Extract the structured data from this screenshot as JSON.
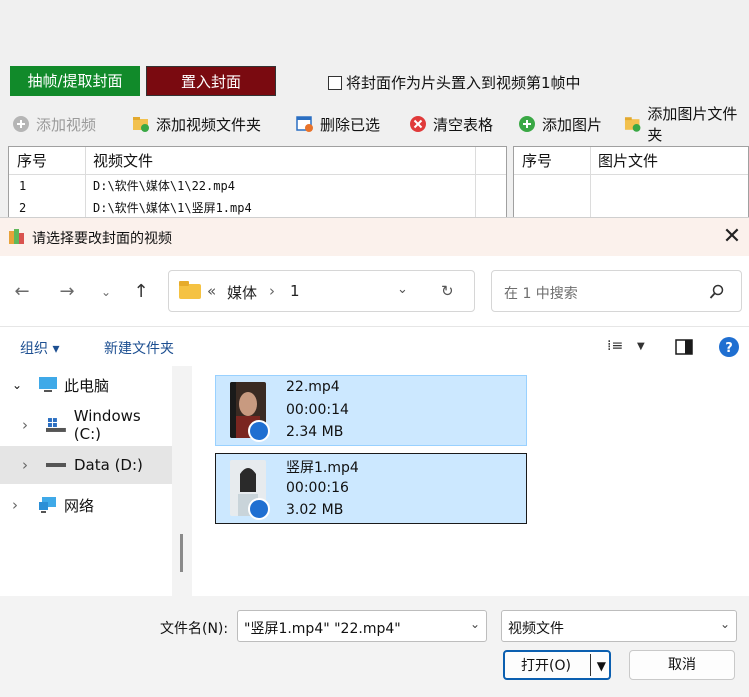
{
  "app": {
    "tabs": {
      "extract": "抽帧/提取封面",
      "embed": "置入封面"
    },
    "first_frame_checkbox": "将封面作为片头置入到视频第1帧中",
    "toolbar": [
      {
        "label": "添加视频",
        "icon": "add-circle-icon",
        "disabled": true
      },
      {
        "label": "添加视频文件夹",
        "icon": "folder-add-icon"
      },
      {
        "label": "删除已选",
        "icon": "delete-selected-icon"
      },
      {
        "label": "清空表格",
        "icon": "clear-icon"
      },
      {
        "label": "添加图片",
        "icon": "add-image-icon"
      },
      {
        "label": "添加图片文件夹",
        "icon": "folder-add-icon"
      }
    ],
    "video_table": {
      "headers": [
        "序号",
        "视频文件"
      ],
      "rows": [
        [
          "1",
          "D:\\软件\\媒体\\1\\22.mp4"
        ],
        [
          "2",
          "D:\\软件\\媒体\\1\\竖屏1.mp4"
        ]
      ]
    },
    "image_table": {
      "headers": [
        "序号",
        "图片文件"
      ]
    }
  },
  "dialog": {
    "title": "请选择要改封面的视频",
    "breadcrumb": {
      "prefix": "«",
      "parts": [
        "媒体",
        "1"
      ]
    },
    "search_placeholder": "在 1 中搜索",
    "commands": {
      "organize": "组织 ▾",
      "new_folder": "新建文件夹"
    },
    "tree": [
      {
        "label": "此电脑",
        "icon": "computer-icon"
      },
      {
        "label": "Windows (C:)",
        "icon": "windows-drive-icon"
      },
      {
        "label": "Data (D:)",
        "icon": "drive-icon",
        "selected": true
      },
      {
        "label": "网络",
        "icon": "network-icon"
      }
    ],
    "files": [
      {
        "name": "22.mp4",
        "duration": "00:00:14",
        "size": "2.34 MB"
      },
      {
        "name": "竖屏1.mp4",
        "duration": "00:00:16",
        "size": "3.02 MB"
      }
    ],
    "filename_label": "文件名(N):",
    "filename_value": "\"竖屏1.mp4\" \"22.mp4\"",
    "filetype_value": "视频文件",
    "open_label": "打开(O)",
    "cancel_label": "取消"
  }
}
